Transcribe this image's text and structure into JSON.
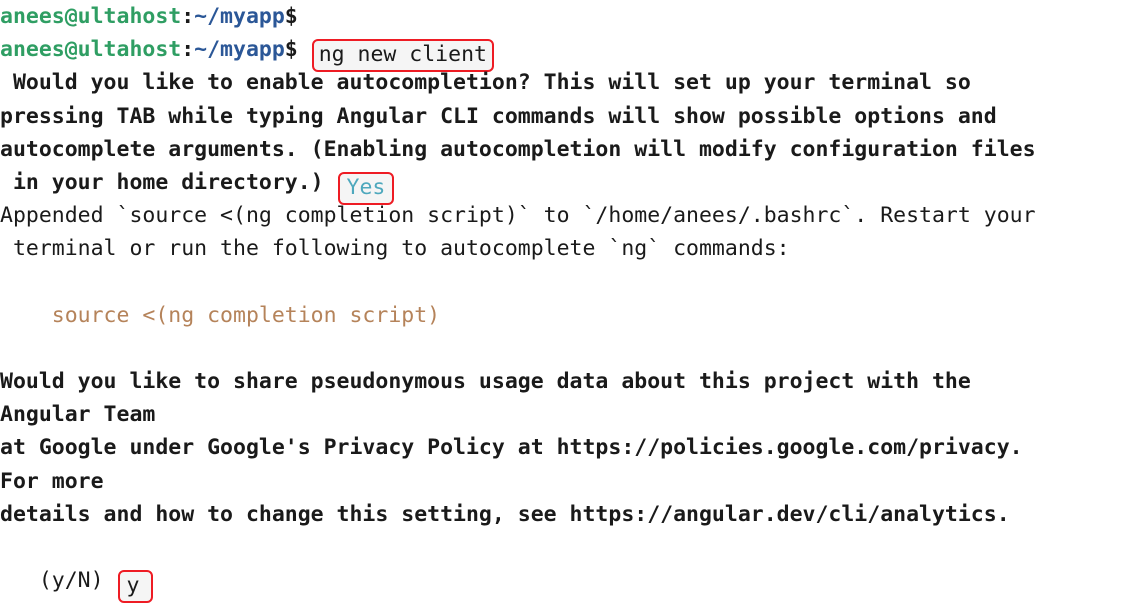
{
  "terminal": {
    "app": "bash-terminal",
    "colors": {
      "background": "#ffffff",
      "foreground": "#1a1a1a",
      "prompt_user": "#2f9e63",
      "prompt_path": "#2b5797",
      "source_command": "#b5835a",
      "answer_yes": "#4ea8bd",
      "highlight_box": "#ee1c24"
    },
    "prompt": {
      "user_host": "anees@ultahost",
      "separator": ":",
      "path": "~/myapp",
      "symbol": "$"
    },
    "lines": {
      "l1_empty_prompt": "",
      "l2_command": "ng new client",
      "l3": " Would you like to enable autocompletion? This will set up your terminal so",
      "l4": "pressing TAB while typing Angular CLI commands will show possible options and",
      "l5": "autocomplete arguments. (Enabling autocompletion will modify configuration files",
      "l6_pre": " in your home directory.) ",
      "l6_answer": "Yes",
      "l7": "Appended `source <(ng completion script)` to `/home/anees/.bashrc`. Restart your",
      "l8": " terminal or run the following to autocomplete `ng` commands:",
      "l9_source": "    source <(ng completion script)",
      "l10": "Would you like to share pseudonymous usage data about this project with the",
      "l11": "Angular Team",
      "l12": "at Google under Google's Privacy Policy at https://policies.google.com/privacy.",
      "l13": "For more",
      "l14": "details and how to change this setting, see https://angular.dev/cli/analytics.",
      "l15_pre": "   (y/N) ",
      "l15_answer": "y"
    }
  }
}
